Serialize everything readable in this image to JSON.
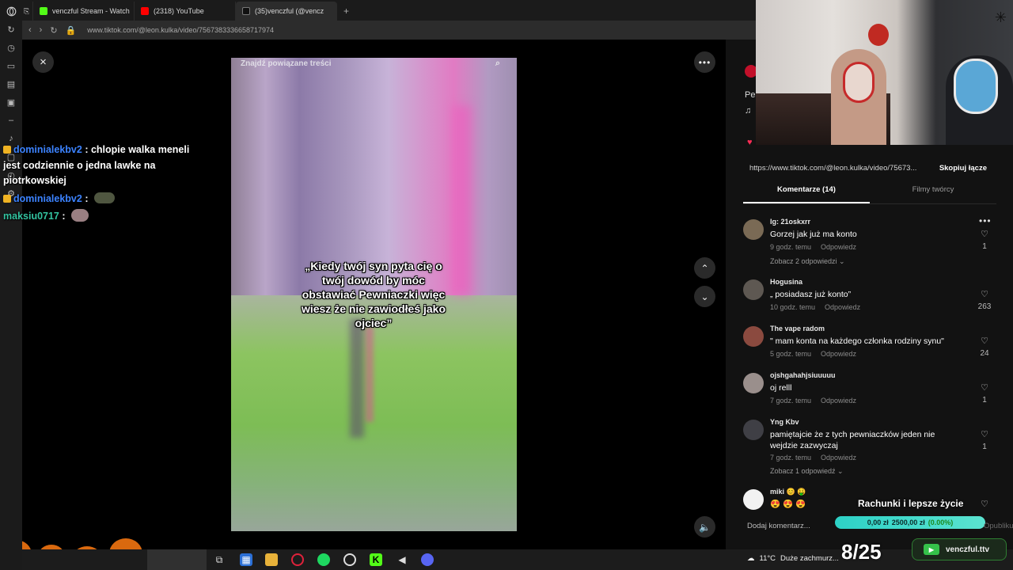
{
  "browser": {
    "tabs": [
      {
        "label": "venczful Stream - Watch",
        "favicon_color": "#53fc18"
      },
      {
        "label": "(2318) YouTube",
        "favicon_color": "#ff0000"
      },
      {
        "label": "(35)venczful (@vencz",
        "favicon_color": "#111111"
      }
    ],
    "new_tab": "+",
    "url": "www.tiktok.com/@leon.kulka/video/7567383336658717974"
  },
  "viewer": {
    "close_icon": "×",
    "more_icon": "•••",
    "search_placeholder": "Znajdź powiązane treści",
    "caption": "„Kiedy twój syn pyta cię o twój dowód by móc obstawiać Pewniaczki więc wiesz że nie zawiodłeś jako ojciec”",
    "nav_up": "⌃",
    "nav_down": "⌄",
    "volume_icon": "🔈"
  },
  "chat": [
    {
      "user": "dominialekbv2",
      "text": ": chlopie walka meneli jest codziennie o jedna lawke na piotrkowskiej",
      "user_color": "#3c83ff"
    },
    {
      "user": "dominialekbv2",
      "text": ":",
      "user_color": "#3c83ff"
    },
    {
      "user": "maksiu0717",
      "text": ":",
      "user_color": "#33c3a0"
    }
  ],
  "panel": {
    "peek_title": "Pe",
    "peek_music": "♫",
    "link": "https://www.tiktok.com/@leon.kulka/video/75673...",
    "copy_label": "Skopiuj łącze",
    "tabs": [
      {
        "label": "Komentarze (14)",
        "active": true
      },
      {
        "label": "Filmy twórcy",
        "active": false
      }
    ],
    "comments": [
      {
        "name": "Ig: 21oskxrr",
        "text": "Gorzej jak już ma konto",
        "time": "9 godz. temu",
        "reply": "Odpowiedz",
        "likes": "1",
        "replies": "Zobacz 2 odpowiedzi ⌄"
      },
      {
        "name": "Hogusina",
        "text": "„ posiadasz już konto”",
        "time": "10 godz. temu",
        "reply": "Odpowiedz",
        "likes": "263",
        "replies": ""
      },
      {
        "name": "The vape radom",
        "text": "\" mam konta na każdego członka rodziny synu\"",
        "time": "5 godz. temu",
        "reply": "Odpowiedz",
        "likes": "24",
        "replies": ""
      },
      {
        "name": "ojshgahahjsiuuuuu",
        "text": "oj relll",
        "time": "7 godz. temu",
        "reply": "Odpowiedz",
        "likes": "1",
        "replies": ""
      },
      {
        "name": "Yng Kbv",
        "text": "pamiętajcie że z tych pewniaczków jeden nie wejdzie zazwyczaj",
        "time": "7 godz. temu",
        "reply": "Odpowiedz",
        "likes": "1",
        "replies": "Zobacz 1 odpowiedź ⌄"
      },
      {
        "name": "miki 😊 🤑",
        "text": "😍 😍 😍",
        "time": "",
        "reply": "",
        "likes": "",
        "replies": ""
      }
    ],
    "add_comment": "Dodaj komentarz...",
    "post": "Opublikuj",
    "overlay_title": "Rachunki i lepsze życie",
    "goal_current": "0,00 zł",
    "goal_target": "2500,00 zł",
    "goal_pct": "(0.00%)",
    "goal_fraction": 0.0
  },
  "taskbar": {
    "weather_temp": "11°C",
    "weather_text": "Duże zachmurz...",
    "counter": "8/25",
    "channel": "venczful.ttv"
  }
}
